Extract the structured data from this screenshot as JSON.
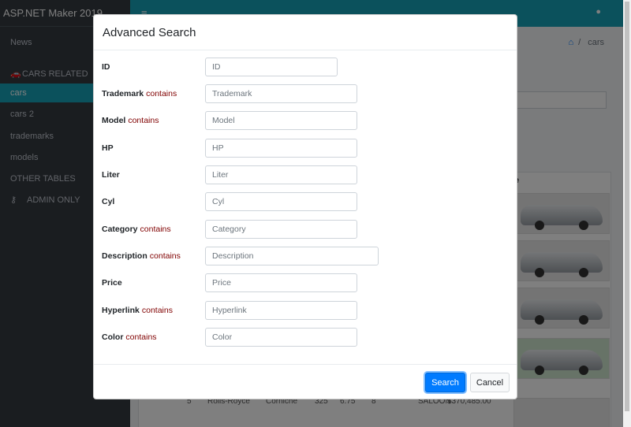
{
  "app": {
    "brand": "ASP.NET Maker 2019"
  },
  "sidebar": {
    "items": [
      {
        "label": "News"
      },
      {
        "label": "CARS RELATED"
      },
      {
        "label": "cars"
      },
      {
        "label": "cars 2"
      },
      {
        "label": "trademarks"
      },
      {
        "label": "models"
      },
      {
        "label": "OTHER TABLES"
      },
      {
        "label": "ADMIN ONLY"
      }
    ]
  },
  "header": {
    "menu_icon": "≡",
    "user_icon": "👤"
  },
  "breadcrumb": {
    "current": "cars",
    "separator": "/"
  },
  "background_table": {
    "column_header": "ure",
    "visible_row": {
      "id": "5",
      "trademark": "Rolls-Royce",
      "model": "Corniche",
      "hp": "325",
      "liter": "6.75",
      "cyl": "8",
      "category": "SALOON",
      "price": "$370,485.00"
    }
  },
  "modal": {
    "title": "Advanced Search",
    "fields": [
      {
        "label": "ID",
        "operator": "",
        "placeholder": "ID"
      },
      {
        "label": "Trademark",
        "operator": "contains",
        "placeholder": "Trademark"
      },
      {
        "label": "Model",
        "operator": "contains",
        "placeholder": "Model"
      },
      {
        "label": "HP",
        "operator": "",
        "placeholder": "HP"
      },
      {
        "label": "Liter",
        "operator": "",
        "placeholder": "Liter"
      },
      {
        "label": "Cyl",
        "operator": "",
        "placeholder": "Cyl"
      },
      {
        "label": "Category",
        "operator": "contains",
        "placeholder": "Category"
      },
      {
        "label": "Description",
        "operator": "contains",
        "placeholder": "Description"
      },
      {
        "label": "Price",
        "operator": "",
        "placeholder": "Price"
      },
      {
        "label": "Hyperlink",
        "operator": "contains",
        "placeholder": "Hyperlink"
      },
      {
        "label": "Color",
        "operator": "contains",
        "placeholder": "Color"
      }
    ],
    "search_button": "Search",
    "cancel_button": "Cancel"
  },
  "colors": {
    "accent": "#17a2b8",
    "primary": "#007bff",
    "sidebar": "#343a40",
    "operator": "#800000"
  }
}
